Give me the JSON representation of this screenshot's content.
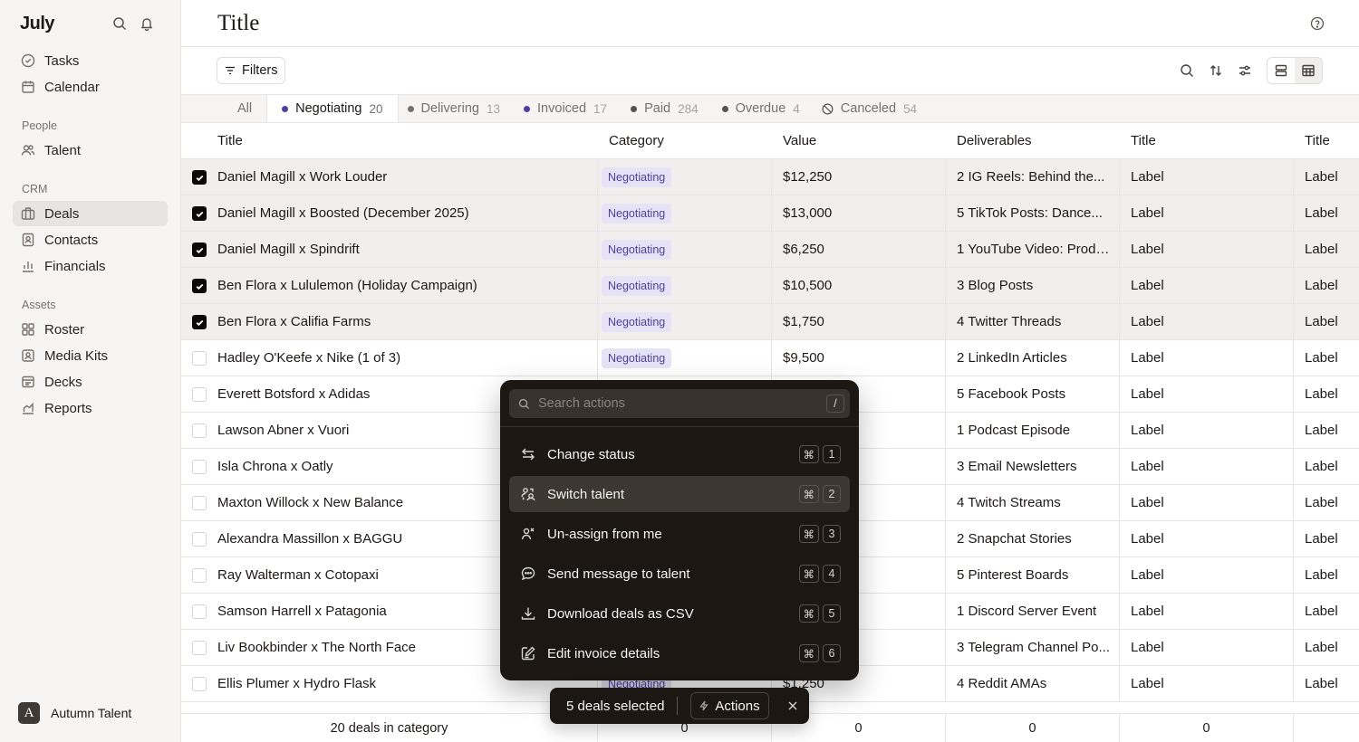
{
  "app": {
    "logo": "July"
  },
  "sidebar": {
    "top_items": [
      {
        "label": "Tasks",
        "icon": "check-circle-icon"
      },
      {
        "label": "Calendar",
        "icon": "calendar-icon"
      }
    ],
    "groups": [
      {
        "label": "People",
        "items": [
          {
            "label": "Talent",
            "icon": "users-icon"
          }
        ]
      },
      {
        "label": "CRM",
        "items": [
          {
            "label": "Deals",
            "icon": "briefcase-icon",
            "active": true
          },
          {
            "label": "Contacts",
            "icon": "contacts-icon"
          },
          {
            "label": "Financials",
            "icon": "chart-icon"
          }
        ]
      },
      {
        "label": "Assets",
        "items": [
          {
            "label": "Roster",
            "icon": "grid-icon"
          },
          {
            "label": "Media Kits",
            "icon": "id-card-icon"
          },
          {
            "label": "Decks",
            "icon": "deck-icon"
          },
          {
            "label": "Reports",
            "icon": "report-icon"
          }
        ]
      }
    ],
    "user": {
      "initial": "A",
      "name": "Autumn Talent"
    }
  },
  "header": {
    "title": "Title"
  },
  "toolbar": {
    "filters_label": "Filters"
  },
  "tabs": [
    {
      "label": "All",
      "count": "",
      "dot": ""
    },
    {
      "label": "Negotiating",
      "count": "20",
      "dot": "#4c3f9e",
      "active": true
    },
    {
      "label": "Delivering",
      "count": "13",
      "dot": "#78716c"
    },
    {
      "label": "Invoiced",
      "count": "17",
      "dot": "#4c3f9e"
    },
    {
      "label": "Paid",
      "count": "284",
      "dot": "#57534e"
    },
    {
      "label": "Overdue",
      "count": "4",
      "dot": "#57534e"
    },
    {
      "label": "Canceled",
      "count": "54",
      "dot": ""
    }
  ],
  "table": {
    "columns": [
      "Title",
      "Category",
      "Value",
      "Deliverables",
      "Title",
      "Title"
    ],
    "rows": [
      {
        "selected": true,
        "title": "Daniel Magill x Work Louder",
        "category": "Negotiating",
        "value": "$12,250",
        "deliverables": "2 IG Reels: Behind the...",
        "c1": "Label",
        "c2": "Label"
      },
      {
        "selected": true,
        "title": "Daniel Magill x Boosted (December 2025)",
        "category": "Negotiating",
        "value": "$13,000",
        "deliverables": "5 TikTok Posts: Dance...",
        "c1": "Label",
        "c2": "Label"
      },
      {
        "selected": true,
        "title": "Daniel Magill x Spindrift",
        "category": "Negotiating",
        "value": "$6,250",
        "deliverables": "1 YouTube Video: Produ...",
        "c1": "Label",
        "c2": "Label"
      },
      {
        "selected": true,
        "title": "Ben Flora x Lululemon (Holiday Campaign)",
        "category": "Negotiating",
        "value": "$10,500",
        "deliverables": "3 Blog Posts",
        "c1": "Label",
        "c2": "Label"
      },
      {
        "selected": true,
        "title": "Ben Flora x Califia Farms",
        "category": "Negotiating",
        "value": "$1,750",
        "deliverables": "4 Twitter Threads",
        "c1": "Label",
        "c2": "Label"
      },
      {
        "selected": false,
        "title": "Hadley O'Keefe x Nike (1 of 3)",
        "category": "Negotiating",
        "value": "$9,500",
        "deliverables": "2 LinkedIn Articles",
        "c1": "Label",
        "c2": "Label"
      },
      {
        "selected": false,
        "title": "Everett Botsford x Adidas",
        "category": "",
        "value": "",
        "deliverables": "5 Facebook Posts",
        "c1": "Label",
        "c2": "Label"
      },
      {
        "selected": false,
        "title": "Lawson Abner x Vuori",
        "category": "",
        "value": "",
        "deliverables": "1 Podcast Episode",
        "c1": "Label",
        "c2": "Label"
      },
      {
        "selected": false,
        "title": "Isla Chrona x Oatly",
        "category": "",
        "value": "",
        "deliverables": "3 Email Newsletters",
        "c1": "Label",
        "c2": "Label"
      },
      {
        "selected": false,
        "title": "Maxton Willock x New Balance",
        "category": "",
        "value": "",
        "deliverables": "4 Twitch Streams",
        "c1": "Label",
        "c2": "Label"
      },
      {
        "selected": false,
        "title": "Alexandra Massillon x BAGGU",
        "category": "",
        "value": "",
        "deliverables": "2 Snapchat Stories",
        "c1": "Label",
        "c2": "Label"
      },
      {
        "selected": false,
        "title": "Ray Walterman x Cotopaxi",
        "category": "",
        "value": "",
        "deliverables": "5 Pinterest Boards",
        "c1": "Label",
        "c2": "Label"
      },
      {
        "selected": false,
        "title": "Samson Harrell x Patagonia",
        "category": "",
        "value": "",
        "deliverables": "1 Discord Server Event",
        "c1": "Label",
        "c2": "Label"
      },
      {
        "selected": false,
        "title": "Liv Bookbinder x The North Face",
        "category": "",
        "value": "",
        "deliverables": "3 Telegram Channel Po...",
        "c1": "Label",
        "c2": "Label"
      },
      {
        "selected": false,
        "title": "Ellis Plumer x Hydro Flask",
        "category": "Negotiating",
        "value": "$1,250",
        "deliverables": "4 Reddit AMAs",
        "c1": "Label",
        "c2": "Label"
      }
    ],
    "footer": {
      "summary": "20 deals in category",
      "totals": [
        "0",
        "0",
        "0",
        "0"
      ]
    }
  },
  "palette": {
    "placeholder": "Search actions",
    "shortcut": "/",
    "items": [
      {
        "label": "Change status",
        "icon": "arrows-exchange-icon",
        "mod": "⌘",
        "key": "1"
      },
      {
        "label": "Switch talent",
        "icon": "switch-user-icon",
        "mod": "⌘",
        "key": "2",
        "highlighted": true
      },
      {
        "label": "Un-assign from me",
        "icon": "user-remove-icon",
        "mod": "⌘",
        "key": "3"
      },
      {
        "label": "Send message to talent",
        "icon": "message-icon",
        "mod": "⌘",
        "key": "4"
      },
      {
        "label": "Download deals as CSV",
        "icon": "download-icon",
        "mod": "⌘",
        "key": "5"
      },
      {
        "label": "Edit invoice details",
        "icon": "edit-icon",
        "mod": "⌘",
        "key": "6"
      }
    ]
  },
  "selection_bar": {
    "count_label": "5 deals selected",
    "actions_label": "Actions"
  },
  "colors": {
    "badge_bg": "#e5e3f5",
    "badge_text": "#4c3f9e",
    "palette_bg": "#1c1713"
  }
}
